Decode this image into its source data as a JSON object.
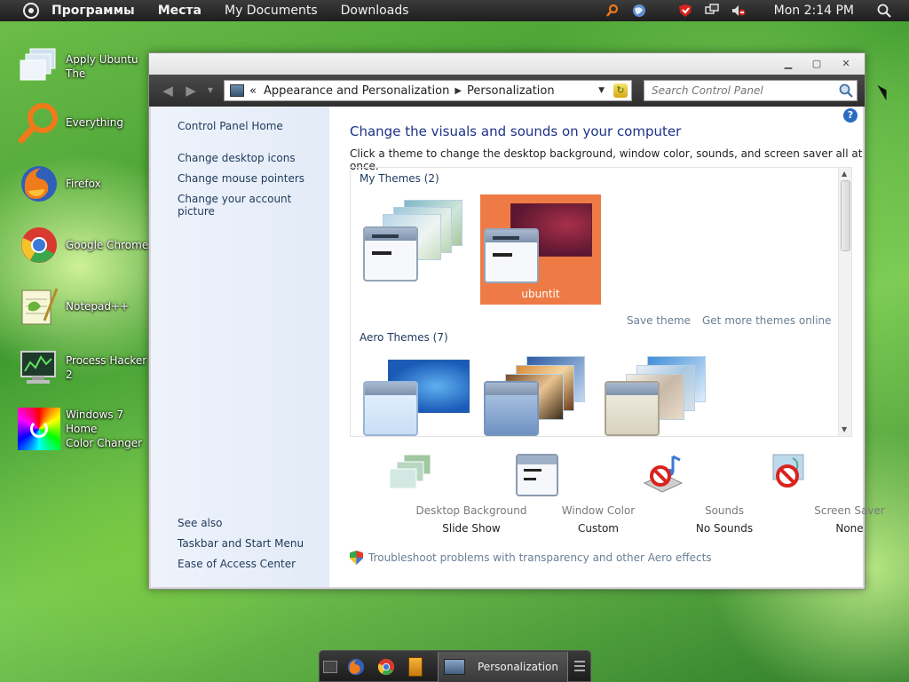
{
  "top_panel": {
    "menus": [
      "Программы",
      "Места",
      "My Documents",
      "Downloads"
    ],
    "clock": "Mon 2:14 PM",
    "tray_icons": [
      "search-tray-icon",
      "globe-icon",
      "shield-tray-icon",
      "network-icon",
      "volume-icon"
    ]
  },
  "desktop_icons": [
    {
      "label": "Apply Ubuntu The",
      "icon": "windows-stack-icon"
    },
    {
      "label": "Everything",
      "icon": "magnifier-icon"
    },
    {
      "label": "Firefox",
      "icon": "firefox-icon"
    },
    {
      "label": "Google Chrome",
      "icon": "chrome-icon"
    },
    {
      "label": "Notepad++",
      "icon": "notepad-icon"
    },
    {
      "label": "Process Hacker 2",
      "icon": "monitor-icon"
    },
    {
      "label": "Windows 7 Home Color Changer",
      "label_line1": "Windows 7 Home",
      "label_line2": "Color Changer",
      "icon": "color-wheel-icon"
    }
  ],
  "window": {
    "breadcrumb": [
      "Appearance and Personalization",
      "Personalization"
    ],
    "breadcrumb_prefix": "«",
    "search_placeholder": "Search Control Panel",
    "help": "?",
    "sidebar": {
      "home": "Control Panel Home",
      "links": [
        "Change desktop icons",
        "Change mouse pointers",
        "Change your account picture"
      ],
      "see_also_title": "See also",
      "see_also": [
        "Taskbar and Start Menu",
        "Ease of Access Center"
      ]
    },
    "heading": "Change the visuals and sounds on your computer",
    "subheading": "Click a theme to change the desktop background, window color, sounds, and screen saver all at once.",
    "my_themes_title": "My Themes (2)",
    "my_themes": [
      {
        "name": ""
      },
      {
        "name": "ubuntit",
        "selected": true
      }
    ],
    "theme_actions": [
      "Save theme",
      "Get more themes online"
    ],
    "aero_themes_title": "Aero Themes (7)",
    "bottom_items": [
      {
        "name": "Desktop Background",
        "value": "Slide Show"
      },
      {
        "name": "Window Color",
        "value": "Custom"
      },
      {
        "name": "Sounds",
        "value": "No Sounds"
      },
      {
        "name": "Screen Saver",
        "value": "None"
      }
    ],
    "troubleshoot": "Troubleshoot problems with transparency and other Aero effects",
    "colors": {
      "selected_tile": "#ee7b45",
      "heading": "#1e3287",
      "link": "#1e395b"
    }
  },
  "dock": {
    "task_label": "Personalization"
  }
}
